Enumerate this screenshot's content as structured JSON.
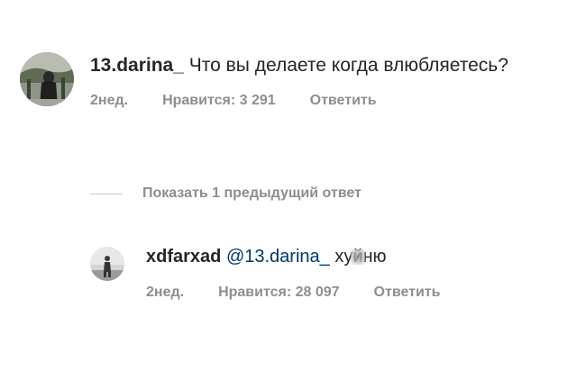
{
  "comment": {
    "username": "13.darina_",
    "text": "Что вы делаете когда влюбляетесь?",
    "time": "2нед.",
    "likes": "Нравится: 3 291",
    "reply_label": "Ответить"
  },
  "view_replies": {
    "label": "Показать 1 предыдущий ответ"
  },
  "reply": {
    "username": "xdfarxad",
    "mention": "@13.darina_",
    "text_start": "ху",
    "text_censored": "й",
    "text_end": "ню",
    "time": "2нед.",
    "likes": "Нравится: 28 097",
    "reply_label": "Ответить"
  },
  "colors": {
    "text": "#262626",
    "meta": "#8e8e8e",
    "mention": "#00376b",
    "divider": "#c7c7c7"
  }
}
